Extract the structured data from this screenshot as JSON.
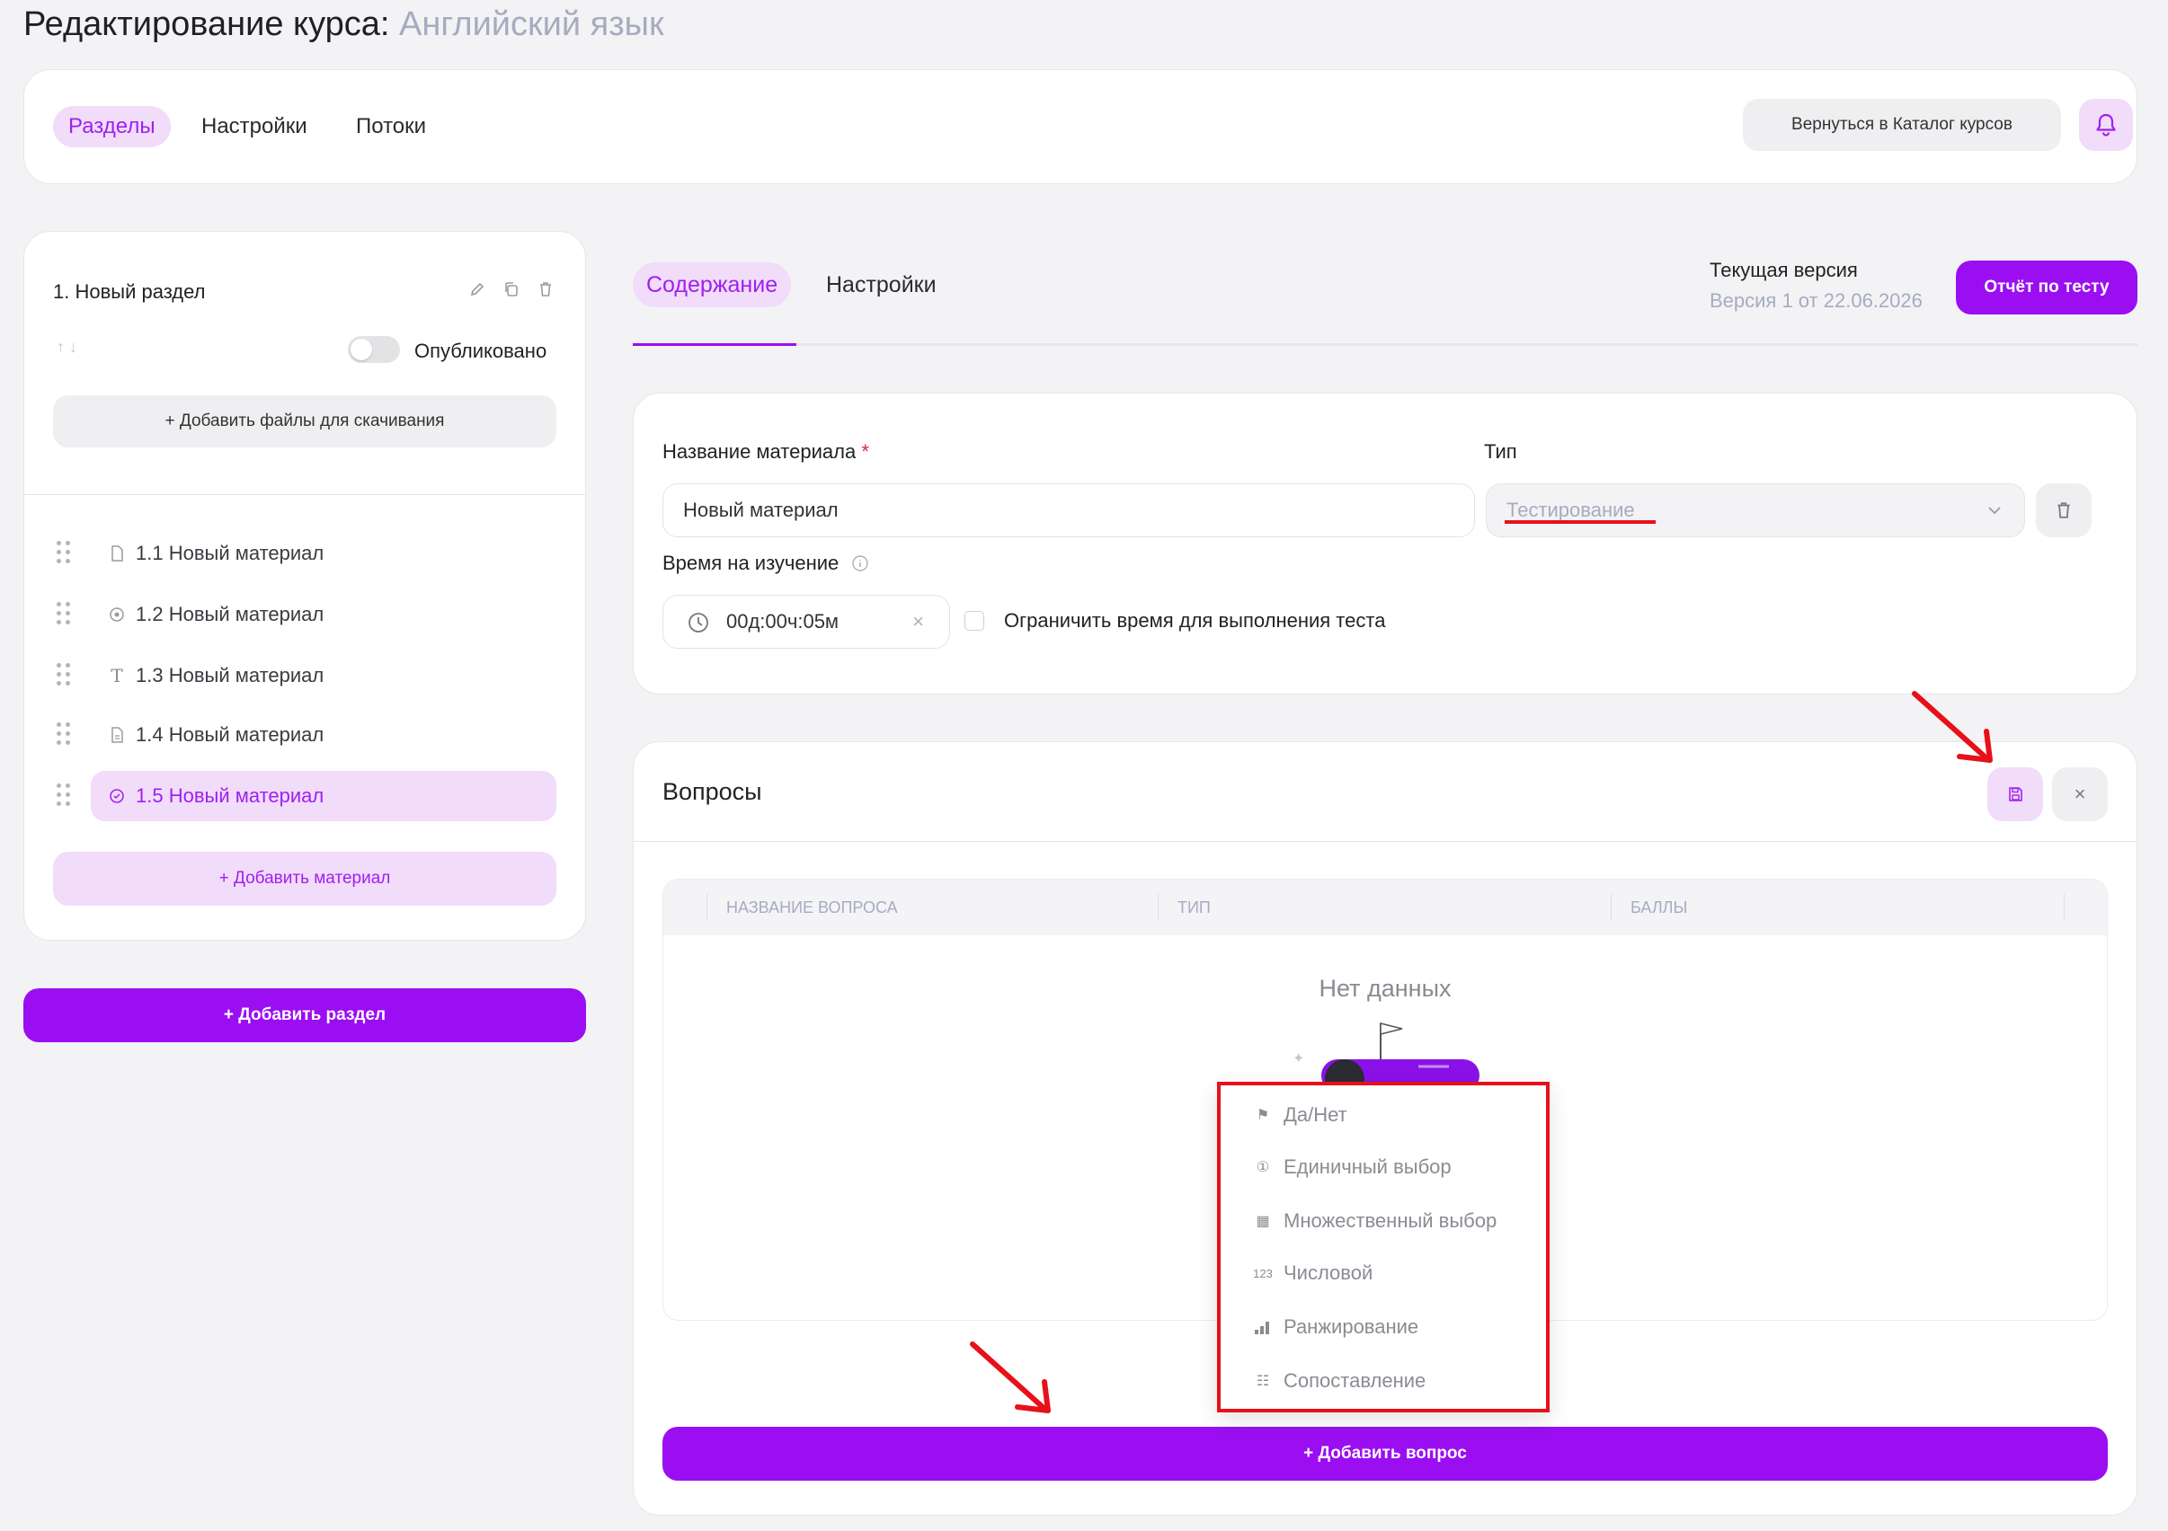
{
  "page": {
    "title_prefix": "Редактирование курса:",
    "course_name": "Английский язык"
  },
  "topbar": {
    "tabs": [
      "Разделы",
      "Настройки",
      "Потоки"
    ],
    "catalog_button": "Вернуться в Каталог курсов"
  },
  "section": {
    "title": "1. Новый раздел",
    "arrows": "↑ ↓",
    "published_label": "Опубликовано",
    "add_files": "+ Добавить файлы для скачивания",
    "materials": [
      {
        "label": "1.1 Новый материал",
        "icon": "document-icon"
      },
      {
        "label": "1.2 Новый материал",
        "icon": "video-icon"
      },
      {
        "label": "1.3 Новый материал",
        "icon": "text-icon"
      },
      {
        "label": "1.4 Новый материал",
        "icon": "file-icon"
      },
      {
        "label": "1.5 Новый материал",
        "icon": "test-icon"
      }
    ],
    "add_material": "+ Добавить материал",
    "add_section": "+ Добавить раздел"
  },
  "content": {
    "tabs": [
      "Содержание",
      "Настройки"
    ],
    "version_label": "Текущая версия",
    "version_value": "Версия 1 от 22.06.2026",
    "report_button": "Отчёт по тесту"
  },
  "form": {
    "name_label": "Название материала",
    "name_required": "*",
    "name_value": "Новый материал",
    "type_label": "Тип",
    "type_value": "Тестирование",
    "time_label": "Время на изучение",
    "time_value": "00д:00ч:05м",
    "limit_label": "Ограничить время для выполнения теста"
  },
  "questions": {
    "title": "Вопросы",
    "columns": [
      "НАЗВАНИЕ ВОПРОСА",
      "ТИП",
      "БАЛЛЫ"
    ],
    "empty": "Нет данных",
    "add_button": "+ Добавить вопрос",
    "types": [
      {
        "label": "Да/Нет",
        "icon": "signpost-icon"
      },
      {
        "label": "Единичный выбор",
        "icon": "single-choice-icon"
      },
      {
        "label": "Множественный выбор",
        "icon": "grid-icon"
      },
      {
        "label": "Числовой",
        "icon": "number-icon"
      },
      {
        "label": "Ранжирование",
        "icon": "bars-icon"
      },
      {
        "label": "Сопоставление",
        "icon": "matching-icon"
      }
    ]
  },
  "colors": {
    "accent": "#9b0ef2",
    "accent_light": "#f1dcfa",
    "annotation": "#e8101a"
  }
}
